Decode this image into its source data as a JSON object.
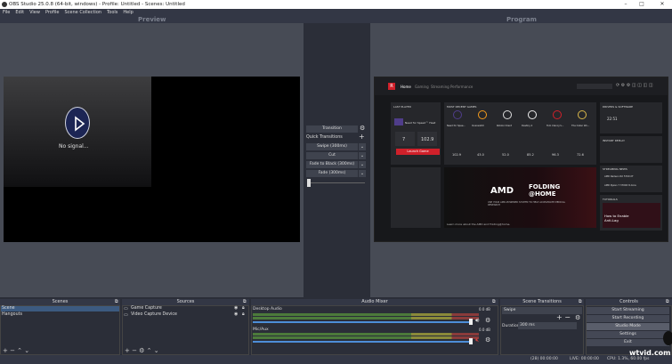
{
  "window": {
    "title": "OBS Studio 25.0.8 (64-bit, windows) - Profile: Untitled - Scenes: Untitled",
    "min": "–",
    "max": "□",
    "close": "✕"
  },
  "menu": [
    "File",
    "Edit",
    "View",
    "Profile",
    "Scene Collection",
    "Tools",
    "Help"
  ],
  "preview": {
    "label": "Preview",
    "no_signal": "No signal..."
  },
  "program": {
    "label": "Program"
  },
  "transitions": {
    "transition": "Transition",
    "quick": "Quick Transitions",
    "items": [
      "Swipe (300ms)",
      "Cut",
      "Fade to Black (300ms)",
      "Fade (300ms)"
    ]
  },
  "amd": {
    "tabs": [
      "Home",
      "Gaming",
      "Streaming",
      "Performance"
    ],
    "last_played": "LAST PLAYED",
    "game": "Need for Speed™ Heat",
    "launch": "Launch Game",
    "recent": "MOST RECENT GAMES",
    "games": [
      "Need for Spee...",
      "Overwatch",
      "Roblox Client",
      "Destiny 2",
      "Tom Clancy's...",
      "The Outer Wo..."
    ],
    "fps": [
      "7",
      "102.9"
    ],
    "vals": [
      "102.9",
      "43.0",
      "52.0",
      "85.2",
      "96.3",
      "72.6"
    ],
    "banner_brand": "AMD",
    "banner_title1": "FOLDING",
    "banner_title2": "@HOME",
    "banner_sub": "USE YOUR AMD-POWERED SYSTEM TO HELP ACCELERATE MEDICAL RESEARCH",
    "banner_link": "Learn more about the AMD and Folding@home.",
    "time": "22:51",
    "driver": "DRIVERS & SOFTWARE",
    "instant": "INSTANT REPLAY",
    "news": "STREAMING NEWS",
    "ryzen": "AMD Radeon RX 5700 XT",
    "drv": "AMD Ryzen 7 3700X 8-Core",
    "tutorials": "TUTORIALS",
    "tut": "How to Enable Anti-Lag"
  },
  "docks": {
    "scenes": "Scenes",
    "sources": "Sources",
    "mixer": "Audio Mixer",
    "scene_transitions": "Scene Transitions",
    "controls": "Controls"
  },
  "scenes": [
    "Scene",
    "Hangouts"
  ],
  "sources": [
    "Game Capture",
    "Video Capture Device"
  ],
  "mixer": [
    {
      "name": "Desktop Audio",
      "db": "0.0 dB"
    },
    {
      "name": "Mic/Aux",
      "db": "0.0 dB"
    }
  ],
  "scene_transition": {
    "type": "Swipe",
    "duration_label": "Duration",
    "duration": "300 ms"
  },
  "controls": [
    "Start Streaming",
    "Start Recording",
    "Studio Mode",
    "Settings",
    "Exit"
  ],
  "status": {
    "dropped": "(28) 00:00:00",
    "rec": "REC: 00:00:00",
    "cpu": "CPU: 1.3%, 60.00 fps",
    "live": "LIVE: 00:00:00"
  },
  "watermark": "wtvid.com"
}
